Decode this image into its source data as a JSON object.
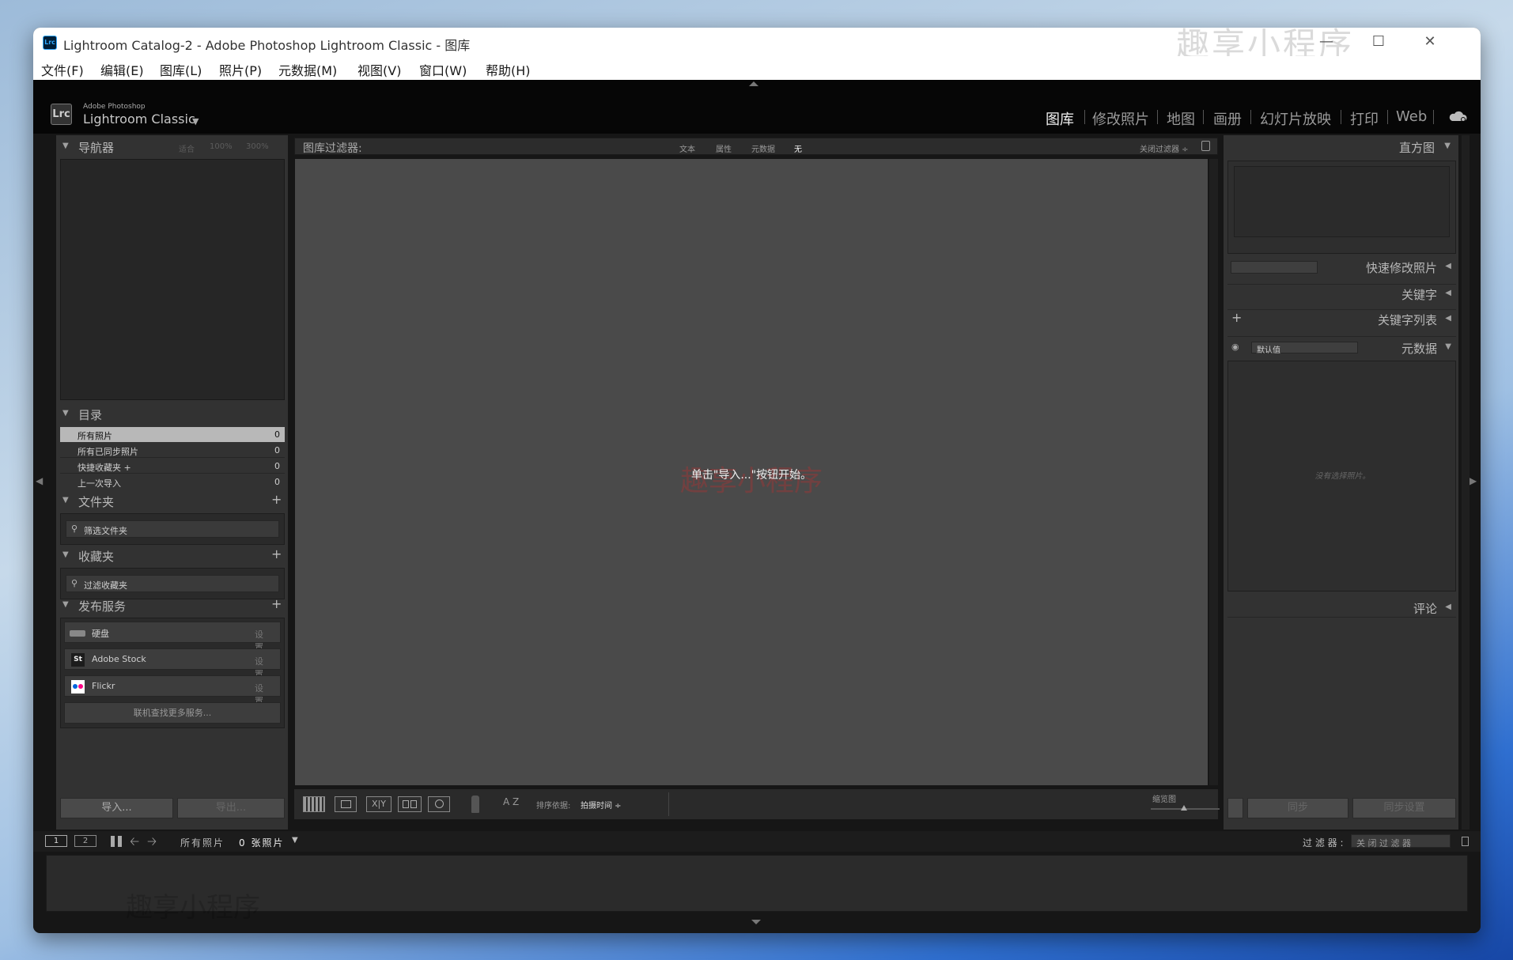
{
  "window": {
    "title": "Lightroom Catalog-2 - Adobe Photoshop Lightroom Classic - 图库",
    "watermark": "趣享小程序",
    "icon": "Lrc",
    "controls": [
      "minimize-icon",
      "maximize-icon",
      "close-icon"
    ]
  },
  "menubar": [
    "文件(F)",
    "编辑(E)",
    "图库(L)",
    "照片(P)",
    "元数据(M)",
    "视图(V)",
    "窗口(W)",
    "帮助(H)"
  ],
  "identity": {
    "logo": "Lrc",
    "line1": "Adobe Photoshop",
    "line2": "Lightroom Classic",
    "dropdown": "▼"
  },
  "modules": [
    {
      "label": "图库",
      "active": true
    },
    {
      "label": "修改照片"
    },
    {
      "label": "地图"
    },
    {
      "label": "画册"
    },
    {
      "label": "幻灯片放映"
    },
    {
      "label": "打印"
    },
    {
      "label": "Web"
    }
  ],
  "left": {
    "navigator": {
      "title": "导航器",
      "zoom": [
        "适合",
        "100%",
        "300%"
      ]
    },
    "catalog": {
      "title": "目录",
      "items": [
        {
          "label": "所有照片",
          "count": "0"
        },
        {
          "label": "所有已同步照片",
          "count": "0"
        },
        {
          "label": "快捷收藏夹 +",
          "count": "0"
        },
        {
          "label": "上一次导入",
          "count": "0"
        }
      ]
    },
    "folders": {
      "title": "文件夹",
      "search": "筛选文件夹",
      "add": "+"
    },
    "collections": {
      "title": "收藏夹",
      "search": "过滤收藏夹",
      "add": "+"
    },
    "publish": {
      "title": "发布服务",
      "add": "+",
      "services": [
        {
          "icon": "hard-disk-icon",
          "label": "硬盘",
          "setup": "设置..."
        },
        {
          "icon": "St",
          "label": "Adobe Stock",
          "setup": "设置..."
        },
        {
          "icon": "flickr-icon",
          "label": "Flickr",
          "setup": "设置..."
        }
      ],
      "more": "联机查找更多服务..."
    },
    "import": "导入...",
    "export": "导出..."
  },
  "filterbar": {
    "title": "图库过滤器:",
    "tabs": [
      "文本",
      "属性",
      "元数据",
      "无"
    ],
    "active": "无",
    "preset": "关闭过滤器 ÷"
  },
  "center": {
    "message": "单击\"导入...\"按钮开始。",
    "watermark": "趣享小程序"
  },
  "toolbar": {
    "sort_label": "排序依据:",
    "sort_value": "拍摄时间 ÷",
    "thumb_label": "缩览图",
    "az": "A Z"
  },
  "right": {
    "histogram": "直方图",
    "quick_develop": "快速修改照片",
    "keywording": "关键字",
    "keyword_list": "关键字列表",
    "keyword_add": "+",
    "metadata": "元数据",
    "metadata_preset": "默认值",
    "no_selection": "没有选择照片。",
    "comments": "评论",
    "sync": "同步",
    "sync_settings": "同步设置"
  },
  "filmstrip": {
    "screen1": "1",
    "screen2": "2",
    "source": "所有照片",
    "count": "0 张照片",
    "filter_label": "过 滤 器 :",
    "filter_value": "关 闭 过 滤 器",
    "watermark": "趣享小程序"
  }
}
